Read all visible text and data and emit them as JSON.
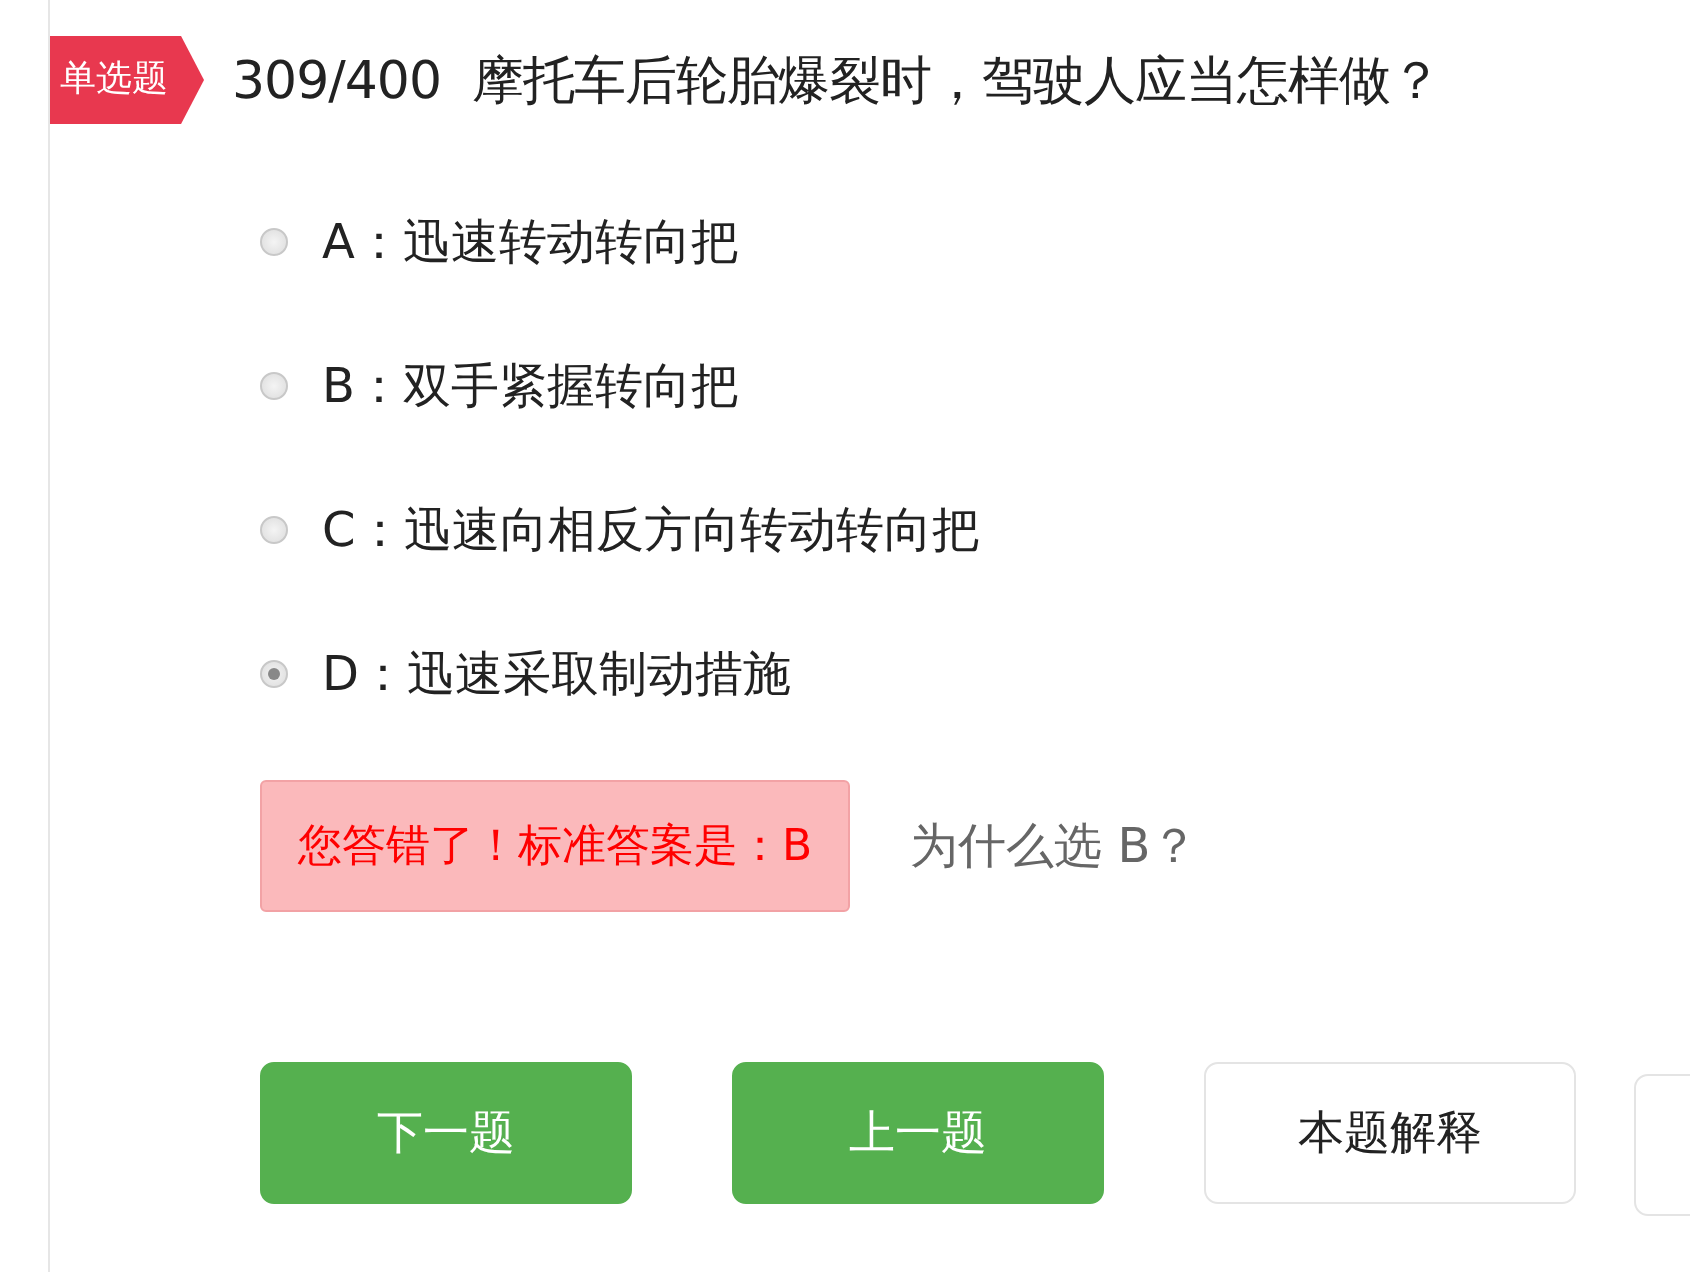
{
  "question": {
    "type_tag": "单选题",
    "number": "309/400",
    "text": "摩托车后轮胎爆裂时，驾驶人应当怎样做？"
  },
  "options": [
    {
      "label": "A：迅速转动转向把",
      "selected": false
    },
    {
      "label": "B：双手紧握转向把",
      "selected": false
    },
    {
      "label": "C：迅速向相反方向转动转向把",
      "selected": false
    },
    {
      "label": "D：迅速采取制动措施",
      "selected": true
    }
  ],
  "result": {
    "message": "您答错了！标准答案是：B",
    "why_link": "为什么选 B？"
  },
  "buttons": [
    {
      "label": "下一题",
      "kind": "primary"
    },
    {
      "label": "上一题",
      "kind": "primary"
    },
    {
      "label": "本题解释",
      "kind": "outline"
    }
  ]
}
